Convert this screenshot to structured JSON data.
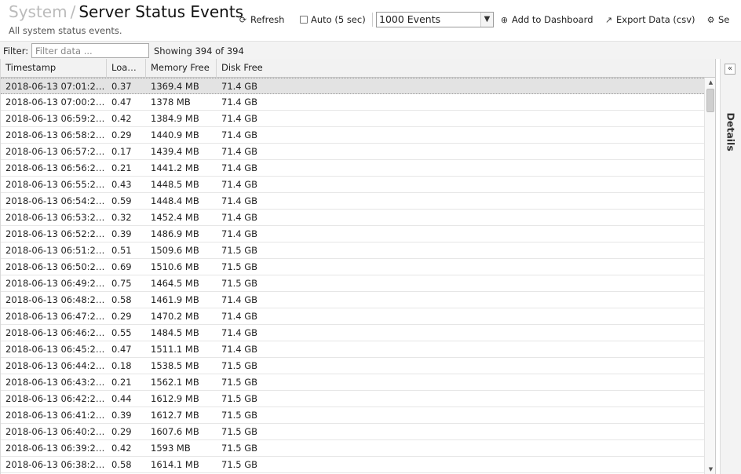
{
  "header": {
    "breadcrumb_parent": "System",
    "breadcrumb_sep": "/",
    "title": "Server Status Events",
    "subtitle": "All system status events."
  },
  "toolbar": {
    "refresh_label": "Refresh",
    "auto_label": "Auto (5 sec)",
    "auto_checked": false,
    "events_select_value": "1000 Events",
    "add_dashboard_label": "Add to Dashboard",
    "export_label": "Export Data (csv)",
    "settings_label": "Se"
  },
  "filter": {
    "label": "Filter:",
    "placeholder": "Filter data ...",
    "value": "",
    "showing": "Showing 394 of 394"
  },
  "grid": {
    "columns": [
      "Timestamp",
      "Loa…",
      "Memory Free",
      "Disk Free"
    ],
    "rows": [
      [
        "2018-06-13 07:01:2…",
        "0.37",
        "1369.4 MB",
        "71.4 GB"
      ],
      [
        "2018-06-13 07:00:2…",
        "0.47",
        "1378 MB",
        "71.4 GB"
      ],
      [
        "2018-06-13 06:59:2…",
        "0.42",
        "1384.9 MB",
        "71.4 GB"
      ],
      [
        "2018-06-13 06:58:2…",
        "0.29",
        "1440.9 MB",
        "71.4 GB"
      ],
      [
        "2018-06-13 06:57:2…",
        "0.17",
        "1439.4 MB",
        "71.4 GB"
      ],
      [
        "2018-06-13 06:56:2…",
        "0.21",
        "1441.2 MB",
        "71.4 GB"
      ],
      [
        "2018-06-13 06:55:2…",
        "0.43",
        "1448.5 MB",
        "71.4 GB"
      ],
      [
        "2018-06-13 06:54:2…",
        "0.59",
        "1448.4 MB",
        "71.4 GB"
      ],
      [
        "2018-06-13 06:53:2…",
        "0.32",
        "1452.4 MB",
        "71.4 GB"
      ],
      [
        "2018-06-13 06:52:2…",
        "0.39",
        "1486.9 MB",
        "71.4 GB"
      ],
      [
        "2018-06-13 06:51:2…",
        "0.51",
        "1509.6 MB",
        "71.5 GB"
      ],
      [
        "2018-06-13 06:50:2…",
        "0.69",
        "1510.6 MB",
        "71.5 GB"
      ],
      [
        "2018-06-13 06:49:2…",
        "0.75",
        "1464.5 MB",
        "71.5 GB"
      ],
      [
        "2018-06-13 06:48:2…",
        "0.58",
        "1461.9 MB",
        "71.4 GB"
      ],
      [
        "2018-06-13 06:47:2…",
        "0.29",
        "1470.2 MB",
        "71.4 GB"
      ],
      [
        "2018-06-13 06:46:2…",
        "0.55",
        "1484.5 MB",
        "71.4 GB"
      ],
      [
        "2018-06-13 06:45:2…",
        "0.47",
        "1511.1 MB",
        "71.4 GB"
      ],
      [
        "2018-06-13 06:44:2…",
        "0.18",
        "1538.5 MB",
        "71.5 GB"
      ],
      [
        "2018-06-13 06:43:2…",
        "0.21",
        "1562.1 MB",
        "71.5 GB"
      ],
      [
        "2018-06-13 06:42:2…",
        "0.44",
        "1612.9 MB",
        "71.5 GB"
      ],
      [
        "2018-06-13 06:41:2…",
        "0.39",
        "1612.7 MB",
        "71.5 GB"
      ],
      [
        "2018-06-13 06:40:2…",
        "0.29",
        "1607.6 MB",
        "71.5 GB"
      ],
      [
        "2018-06-13 06:39:2…",
        "0.42",
        "1593 MB",
        "71.5 GB"
      ],
      [
        "2018-06-13 06:38:2…",
        "0.58",
        "1614.1 MB",
        "71.5 GB"
      ]
    ]
  },
  "details": {
    "label": "Details"
  },
  "icons": {
    "refresh": "refresh-icon",
    "add_dashboard": "plus-circle-icon",
    "export": "export-icon",
    "settings": "gear-icon",
    "collapse": "double-chevron-left-icon",
    "select_arrow": "chevron-down-icon"
  }
}
